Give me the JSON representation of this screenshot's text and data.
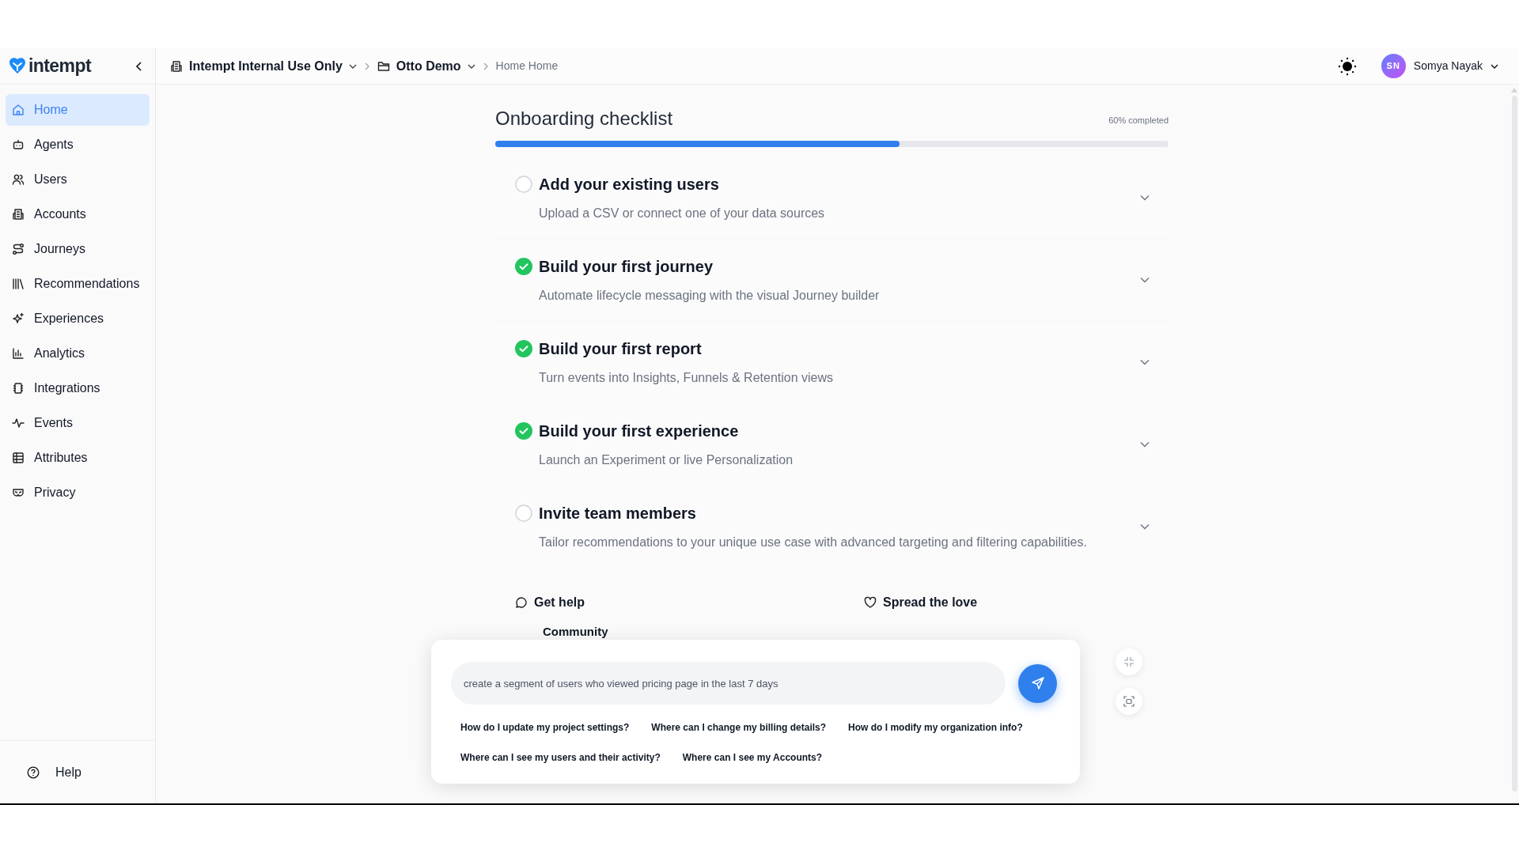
{
  "sidebar": {
    "logo": "intempt",
    "items": [
      {
        "kind": "home",
        "label": "Home",
        "selected": true
      },
      {
        "kind": "bot",
        "label": "Agents",
        "selected": false
      },
      {
        "kind": "users",
        "label": "Users",
        "selected": false
      },
      {
        "kind": "building",
        "label": "Accounts",
        "selected": false
      },
      {
        "kind": "route",
        "label": "Journeys",
        "selected": false
      },
      {
        "kind": "library",
        "label": "Recommendations",
        "selected": false
      },
      {
        "kind": "sparkles",
        "label": "Experiences",
        "selected": false
      },
      {
        "kind": "chart",
        "label": "Analytics",
        "selected": false
      },
      {
        "kind": "chip",
        "label": "Integrations",
        "selected": false
      },
      {
        "kind": "pulse",
        "label": "Events",
        "selected": false
      },
      {
        "kind": "table",
        "label": "Attributes",
        "selected": false
      },
      {
        "kind": "mask",
        "label": "Privacy",
        "selected": false
      }
    ],
    "help": "Help"
  },
  "breadcrumb": [
    {
      "kind": "org",
      "label": "Intempt Internal Use Only"
    },
    {
      "kind": "project",
      "label": "Otto Demo"
    },
    {
      "kind": "page",
      "label": "Home Home"
    }
  ],
  "user": {
    "initials": "SN",
    "name": "Somya Nayak"
  },
  "checklist": {
    "title": "Onboarding checklist",
    "progress_text": "60% completed",
    "level": 0.6,
    "items": [
      {
        "title": "Add your existing users",
        "description": "Upload a CSV or connect one of your data sources",
        "done": false
      },
      {
        "title": "Build your first journey",
        "description": "Automate lifecycle messaging with the visual Journey builder",
        "done": true
      },
      {
        "title": "Build your first report",
        "description": "Turn events into Insights, Funnels & Retention views",
        "done": true
      },
      {
        "title": "Build your first experience",
        "description": "Launch an Experiment or live Personalization",
        "done": true
      },
      {
        "title": "Invite team members",
        "description": "Tailor recommendations to your unique use case with advanced targeting and filtering capabilities.",
        "done": false
      }
    ]
  },
  "footer_links": [
    {
      "kind": "help",
      "label": "Get help"
    },
    {
      "kind": "love",
      "label": "Spread the love"
    }
  ],
  "community": "Community",
  "chat": {
    "value": "create a segment of users who viewed pricing page in the last 7 days",
    "suggestions": [
      [
        "How do I update my project settings?",
        "Where can I change my billing details?",
        "How do I modify my organization info?"
      ],
      [
        "Where can I see my users and their activity?",
        "Where can I see my Accounts?"
      ]
    ]
  }
}
